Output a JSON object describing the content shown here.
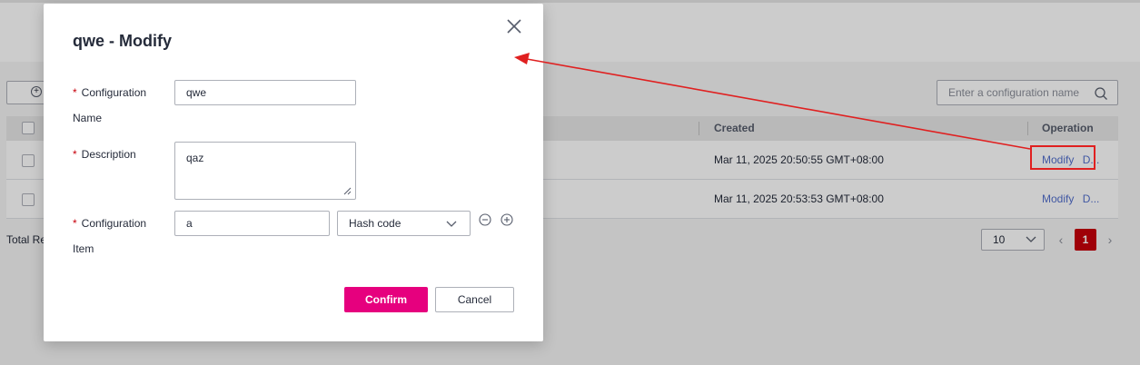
{
  "background": {
    "add_button_label": "",
    "search": {
      "placeholder": "Enter a configuration name"
    },
    "table": {
      "headers": {
        "created": "Created",
        "operation": "Operation"
      },
      "rows": [
        {
          "created": "Mar 11, 2025 20:50:55 GMT+08:00",
          "modify": "Modify",
          "more": "D..."
        },
        {
          "created": "Mar 11, 2025 20:53:53 GMT+08:00",
          "modify": "Modify",
          "more": "D..."
        }
      ]
    },
    "total_label": "Total Re",
    "pagination": {
      "page_size": "10",
      "current_page": "1",
      "prev": "‹",
      "next": "›"
    }
  },
  "modal": {
    "title": "qwe - Modify",
    "fields": {
      "name": {
        "label_line1": "Configuration",
        "label_line2": "Name",
        "value": "qwe"
      },
      "description": {
        "label": "Description",
        "value": "qaz"
      },
      "item": {
        "label_line1": "Configuration",
        "label_line2": "Item",
        "value": "a",
        "type": "Hash code"
      }
    },
    "required_mark": "*",
    "confirm_label": "Confirm",
    "cancel_label": "Cancel"
  },
  "colors": {
    "primary_button": "#e6007e",
    "pagination_active": "#c7000b",
    "link": "#526ecc",
    "annotation": "#e02020"
  },
  "icons": [
    "close-icon",
    "search-icon",
    "chevron-down-icon",
    "minus-circle-icon",
    "plus-circle-icon",
    "resize-grip-icon"
  ]
}
